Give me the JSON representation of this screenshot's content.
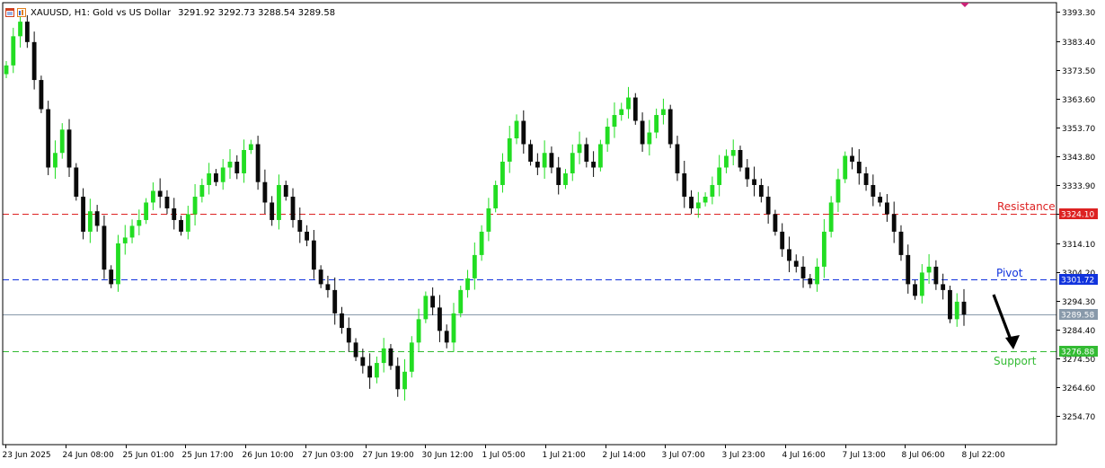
{
  "header": {
    "symbol_title": "XAUUSD, H1:  Gold vs US Dollar",
    "ohlc": "3291.92 3292.73 3288.54 3289.58"
  },
  "colors": {
    "bull": "#22dd22",
    "bear": "#0a0a0a",
    "resistance": "#dd2222",
    "pivot": "#1133dd",
    "support": "#33bb33",
    "last_price": "#8899aa",
    "axis": "#000000"
  },
  "icons": [
    "chart-window-icon",
    "symbol-menu-icon",
    "trade-arrow-marker-icon"
  ],
  "chart_data": {
    "type": "candlestick",
    "symbol": "XAUUSD",
    "timeframe": "H1",
    "ylim": [
      3245.0,
      3396.5
    ],
    "y_ticks": [
      "3393.30",
      "3383.40",
      "3373.50",
      "3363.60",
      "3353.70",
      "3343.80",
      "3333.90",
      "3324.00",
      "3314.10",
      "3304.20",
      "3294.30",
      "3284.40",
      "3274.50",
      "3264.60",
      "3254.70"
    ],
    "x_ticks": [
      "23 Jun 2025",
      "24 Jun 08:00",
      "25 Jun 01:00",
      "25 Jun 17:00",
      "26 Jun 10:00",
      "27 Jun 03:00",
      "27 Jun 19:00",
      "30 Jun 12:00",
      "1 Jul 05:00",
      "1 Jul 21:00",
      "2 Jul 14:00",
      "3 Jul 07:00",
      "3 Jul 23:00",
      "4 Jul 16:00",
      "7 Jul 13:00",
      "8 Jul 06:00",
      "8 Jul 22:00"
    ],
    "levels": [
      {
        "label": "Resistance",
        "value": 3324.1,
        "tag": "3324.10",
        "color": "#dd2222"
      },
      {
        "label": "Pivot",
        "value": 3301.72,
        "tag": "3301.72",
        "color": "#1133dd"
      },
      {
        "label": "Support",
        "value": 3276.88,
        "tag": "3276.88",
        "color": "#33bb33"
      }
    ],
    "last_price": {
      "value": 3289.58,
      "tag": "3289.58"
    },
    "closes": [
      3375,
      3385,
      3390,
      3383,
      3370,
      3360,
      3340,
      3345,
      3353,
      3340,
      3330,
      3318,
      3325,
      3320,
      3305,
      3300,
      3314,
      3316,
      3320,
      3322,
      3328,
      3332,
      3330,
      3326,
      3322,
      3318,
      3324,
      3330,
      3334,
      3338,
      3335,
      3340,
      3342,
      3338,
      3346,
      3348,
      3335,
      3328,
      3322,
      3334,
      3330,
      3322,
      3318,
      3315,
      3305,
      3300,
      3298,
      3290,
      3285,
      3280,
      3275,
      3272,
      3268,
      3273,
      3278,
      3272,
      3264,
      3270,
      3280,
      3288,
      3296,
      3292,
      3284,
      3280,
      3290,
      3298,
      3302,
      3310,
      3318,
      3326,
      3334,
      3342,
      3350,
      3356,
      3348,
      3342,
      3340,
      3345,
      3340,
      3334,
      3338,
      3345,
      3348,
      3342,
      3340,
      3348,
      3354,
      3358,
      3360,
      3364,
      3356,
      3348,
      3352,
      3358,
      3360,
      3348,
      3338,
      3330,
      3326,
      3328,
      3330,
      3334,
      3340,
      3344,
      3346,
      3340,
      3336,
      3334,
      3330,
      3324,
      3318,
      3312,
      3308,
      3306,
      3302,
      3300,
      3306,
      3318,
      3328,
      3336,
      3344,
      3342,
      3338,
      3334,
      3330,
      3328,
      3324,
      3318,
      3310,
      3300,
      3296,
      3304,
      3306,
      3300,
      3298,
      3288,
      3294,
      3289.58
    ]
  }
}
